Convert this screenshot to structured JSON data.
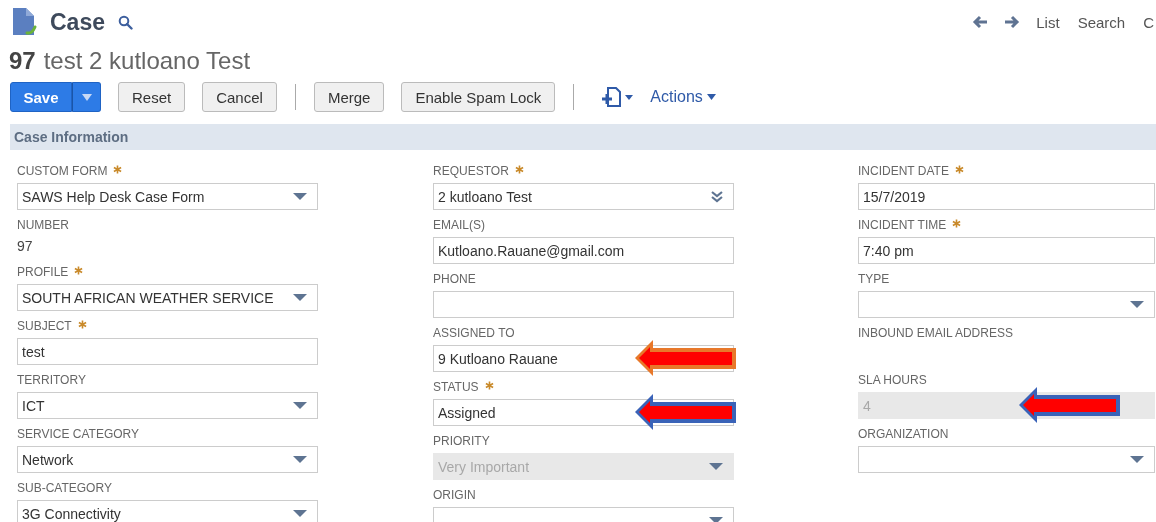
{
  "header": {
    "title": "Case",
    "nav": [
      "List",
      "Search",
      "C"
    ]
  },
  "record": {
    "number": "97",
    "name": "test 2 kutloano Test"
  },
  "toolbar": [
    {
      "kind": "primary",
      "label": "Save"
    },
    {
      "kind": "plain",
      "label": "Reset"
    },
    {
      "kind": "plain",
      "label": "Cancel"
    },
    {
      "kind": "separator"
    },
    {
      "kind": "plain",
      "label": "Merge"
    },
    {
      "kind": "plain",
      "label": "Enable Spam Lock"
    },
    {
      "kind": "separator"
    },
    {
      "kind": "icon-menu"
    },
    {
      "kind": "menu",
      "label": "Actions"
    }
  ],
  "section": {
    "title": "Case Information"
  },
  "columns": [
    {
      "fields": [
        {
          "label": "CUSTOM FORM",
          "required": true,
          "kind": "select",
          "disabled": false,
          "value": "SAWS Help Desk Case Form"
        },
        {
          "label": "NUMBER",
          "required": false,
          "kind": "static",
          "value": "97"
        },
        {
          "label": "PROFILE",
          "required": true,
          "kind": "select",
          "disabled": false,
          "value": "SOUTH AFRICAN WEATHER SERVICE"
        },
        {
          "label": "SUBJECT",
          "required": true,
          "kind": "text",
          "disabled": false,
          "value": "test"
        },
        {
          "label": "TERRITORY",
          "required": false,
          "kind": "select",
          "disabled": false,
          "value": "ICT"
        },
        {
          "label": "SERVICE CATEGORY",
          "required": false,
          "kind": "select",
          "disabled": false,
          "value": "Network"
        },
        {
          "label": "SUB-CATEGORY",
          "required": false,
          "kind": "select",
          "disabled": false,
          "value": "3G Connectivity"
        }
      ]
    },
    {
      "fields": [
        {
          "label": "REQUESTOR",
          "required": true,
          "kind": "lookup",
          "disabled": false,
          "value": "2 kutloano Test"
        },
        {
          "label": "EMAIL(S)",
          "required": false,
          "kind": "text",
          "disabled": false,
          "value": "Kutloano.Rauane@gmail.com"
        },
        {
          "label": "PHONE",
          "required": false,
          "kind": "text",
          "disabled": false
        },
        {
          "label": "ASSIGNED TO",
          "required": false,
          "kind": "text",
          "disabled": false,
          "value": "9 Kutloano Rauane",
          "arrow": {
            "color": "#e8782a"
          }
        },
        {
          "label": "STATUS",
          "required": true,
          "kind": "text",
          "disabled": false,
          "value": "Assigned",
          "arrow": {
            "color": "#3a63b8"
          }
        },
        {
          "label": "PRIORITY",
          "required": false,
          "kind": "select",
          "disabled": true,
          "value": "Very Important"
        },
        {
          "label": "ORIGIN",
          "required": false,
          "kind": "select",
          "disabled": false
        }
      ]
    },
    {
      "fields": [
        {
          "label": "INCIDENT DATE",
          "required": true,
          "kind": "text",
          "disabled": false,
          "value": "15/7/2019"
        },
        {
          "label": "INCIDENT TIME",
          "required": true,
          "kind": "text",
          "disabled": false,
          "value": "7:40 pm"
        },
        {
          "label": "TYPE",
          "required": false,
          "kind": "select",
          "disabled": false
        },
        {
          "label": "INBOUND EMAIL ADDRESS",
          "required": false,
          "kind": "static"
        },
        {
          "label": "SLA HOURS",
          "required": false,
          "kind": "text",
          "disabled": true,
          "value": "4",
          "arrow": {
            "color": "#3a63b8"
          }
        },
        {
          "label": "ORGANIZATION",
          "required": false,
          "kind": "select",
          "disabled": false
        }
      ]
    }
  ]
}
